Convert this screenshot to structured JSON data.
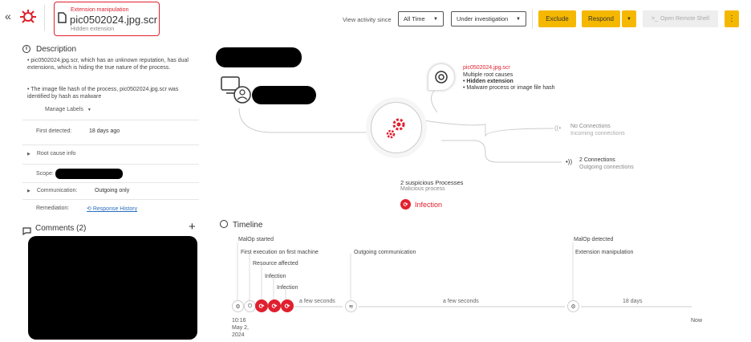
{
  "header": {
    "collapse_icon": "«",
    "alert_title": "Extension manipulation",
    "file_name": "pic0502024.jpg.scr",
    "subtitle": "Hidden extension",
    "view_activity_label": "View activity since",
    "time_select": "All Time",
    "status_select": "Under investigation",
    "exclude_label": "Exclude",
    "respond_label": "Respond",
    "remote_shell_label": "Open Remote Shell",
    "more_icon": "⋮"
  },
  "description": {
    "heading": "Description",
    "bullets": [
      "pic0502024.jpg.scr, which has an unknown reputation, has dual extensions, which is hiding the true nature of the process.",
      "The image file hash of the process, pic0502024.jpg.scr was identified by hash as malware"
    ],
    "manage_labels": "Manage Labels",
    "first_detected_label": "First detected:",
    "first_detected_value": "18 days ago",
    "root_cause_info": "Root cause info",
    "scope_label": "Scope:",
    "communication_label": "Communication:",
    "communication_value": "Outgoing only",
    "remediation_label": "Remediation:",
    "response_history": "Response History"
  },
  "comments": {
    "heading": "Comments (2)",
    "add_icon": "+"
  },
  "graph": {
    "root_file": "pic0502024.jpg.scr",
    "root_causes_label": "Multiple root causes",
    "root_bullet_1": "Hidden extension",
    "root_bullet_2": "Malware process or image file hash",
    "no_connections": "No Connections",
    "incoming_connections": "Incoming connections",
    "two_connections": "2 Connections",
    "outgoing_connections": "Outgoing connections",
    "suspicious_processes": "2 suspicious Processes",
    "malicious_process": "Malicious process",
    "infection": "Infection"
  },
  "timeline": {
    "heading": "Timeline",
    "malop_started": "MalOp started",
    "first_execution": "First execution on first machine",
    "resource_affected": "Resource affected",
    "infection_1": "Infection",
    "infection_2": "Infection",
    "outgoing_communication": "Outgoing communication",
    "malop_detected": "MalOp detected",
    "extension_manipulation": "Extension manipulation",
    "gap_1": "a few seconds",
    "gap_2": "a few seconds",
    "gap_3": "18 days",
    "start_time": "10:16",
    "start_date": "May 2,",
    "start_year": "2024",
    "now": "Now"
  }
}
